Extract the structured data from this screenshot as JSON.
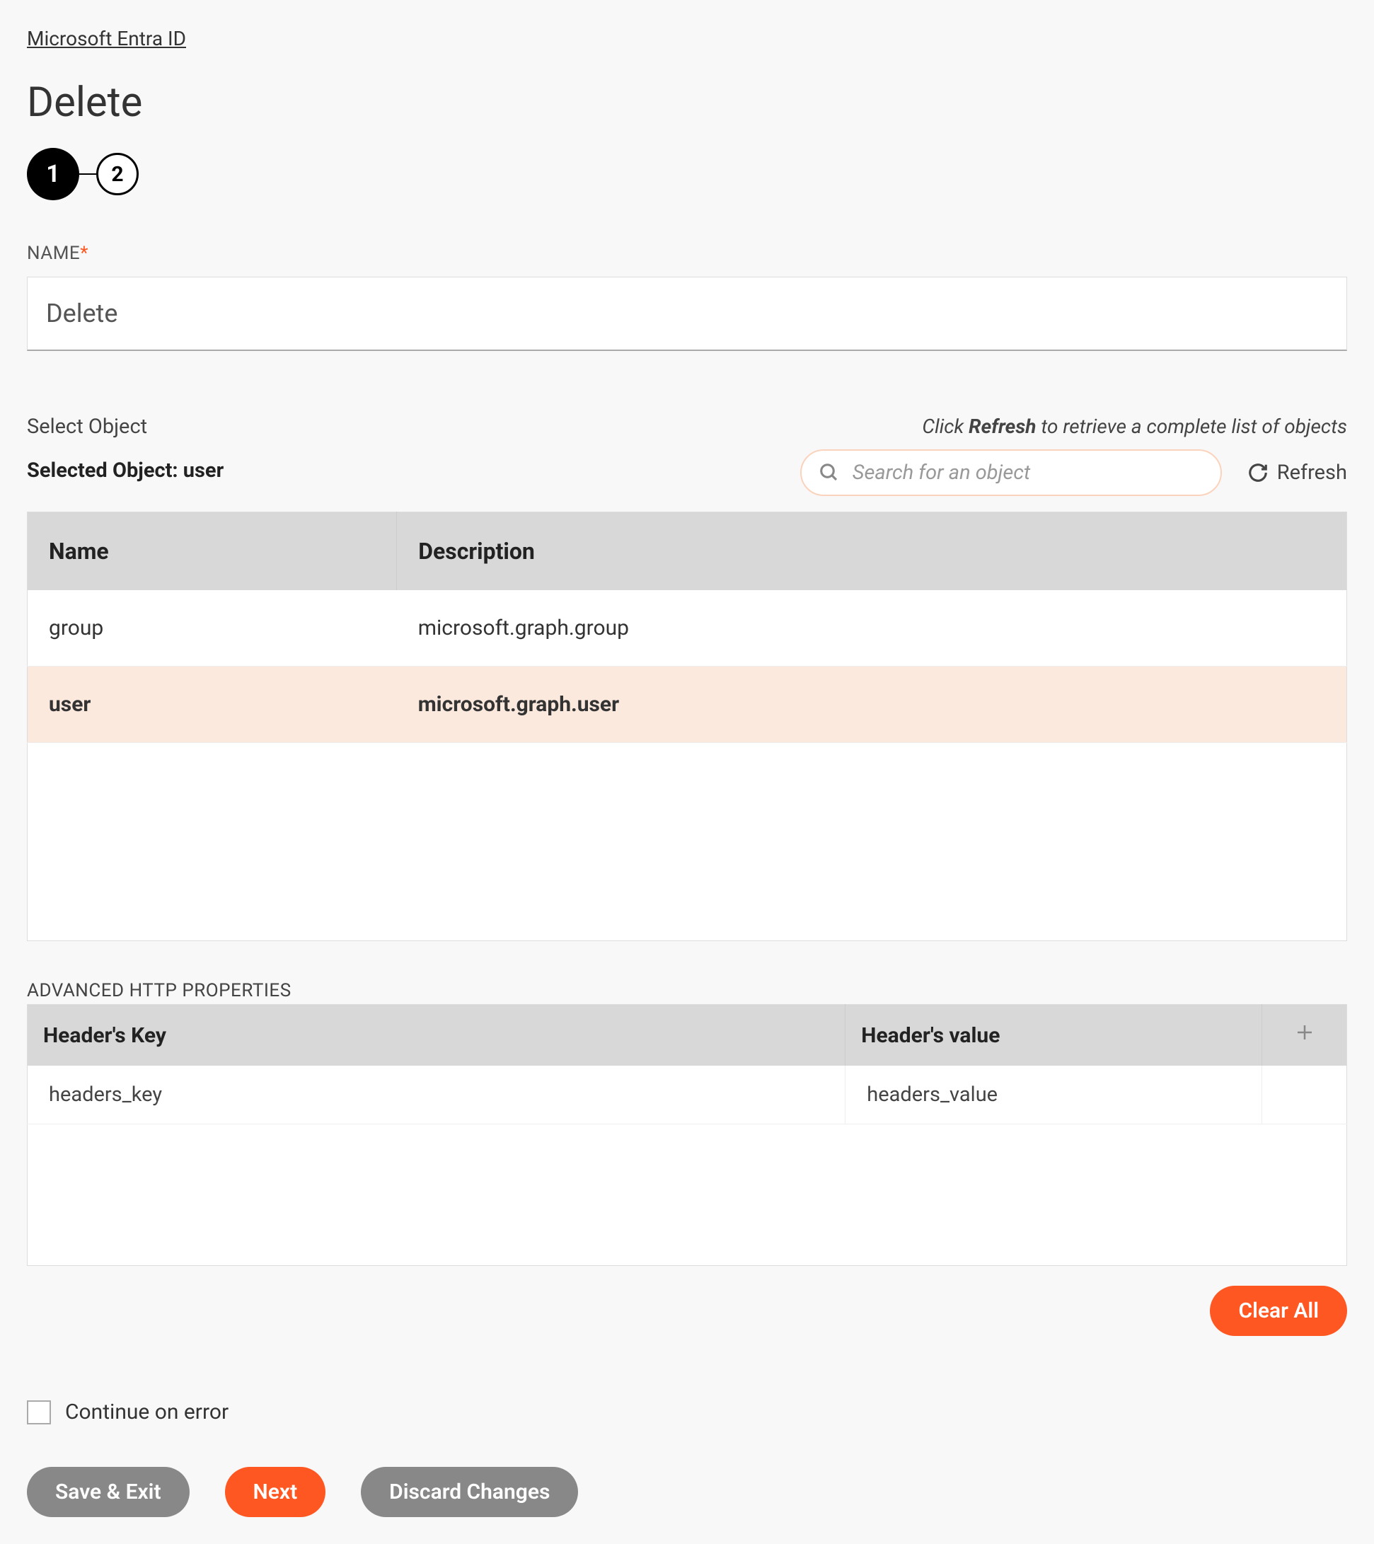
{
  "breadcrumb": "Microsoft Entra ID",
  "page_title": "Delete",
  "stepper": {
    "step1": "1",
    "step2": "2"
  },
  "name_field": {
    "label": "NAME",
    "required_marker": "*",
    "value": "Delete"
  },
  "select_section": {
    "label": "Select Object",
    "selected_prefix": "Selected Object: ",
    "selected_value": "user",
    "hint_prefix": "Click ",
    "hint_bold": "Refresh",
    "hint_suffix": " to retrieve a complete list of objects",
    "search_placeholder": "Search for an object",
    "refresh_label": "Refresh"
  },
  "object_table": {
    "col_name": "Name",
    "col_description": "Description",
    "rows": [
      {
        "name": "group",
        "description": "microsoft.graph.group"
      },
      {
        "name": "user",
        "description": "microsoft.graph.user"
      }
    ]
  },
  "advanced": {
    "label": "ADVANCED HTTP PROPERTIES",
    "col_key": "Header's Key",
    "col_value": "Header's value",
    "rows": [
      {
        "key": "headers_key",
        "value": "headers_value"
      }
    ]
  },
  "buttons": {
    "clear_all": "Clear All",
    "continue_error": "Continue on error",
    "save_exit": "Save & Exit",
    "next": "Next",
    "discard": "Discard Changes"
  }
}
